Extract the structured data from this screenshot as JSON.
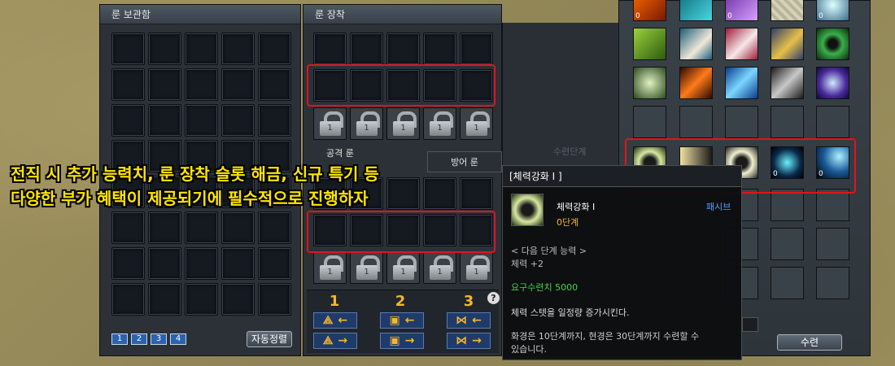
{
  "storage_panel": {
    "title": "룬 보관함",
    "pages": [
      "1",
      "2",
      "3",
      "4"
    ],
    "sort_label": "자동정렬"
  },
  "equip_panel": {
    "title": "룬 장착",
    "attack_label": "공격 룬",
    "defense_label": "방어 룬",
    "sets": [
      "1",
      "2",
      "3"
    ],
    "help": "?"
  },
  "right_panel": {
    "faded_label": "수련단계",
    "train_label": "수련"
  },
  "caption": {
    "line1": "전직 시 추가 능력치, 룬 장착 슬롯 해금, 신규 특기 등",
    "line2": "다양한 부가 혜택이 제공되기에 필수적으로 진행하자"
  },
  "tooltip": {
    "title": "[체력강화 I ]",
    "skill_name": "체력강화 I",
    "type": "패시브",
    "level": "0단계",
    "next_heading": "< 다음 단계 능력 >",
    "next_value": "체력 +2",
    "requirement": "요구수련치 5000",
    "description": "체력 스텟을 일정량 증가시킨다.",
    "note_line1": "화경은 10단계까지, 현경은 30단계까지 수련할 수",
    "note_line2": "있습니다."
  },
  "skills": {
    "row0": [
      "0",
      "0",
      "",
      "",
      "0"
    ],
    "highlight": [
      "0",
      "0",
      "0",
      "0",
      "0"
    ]
  },
  "colors": {
    "highlight_red": "#e0141e",
    "caption_yellow": "#ffe600",
    "accent_orange": "#f3b72d",
    "passive_blue": "#5aa0ff",
    "requirement_green": "#4bd24b"
  }
}
